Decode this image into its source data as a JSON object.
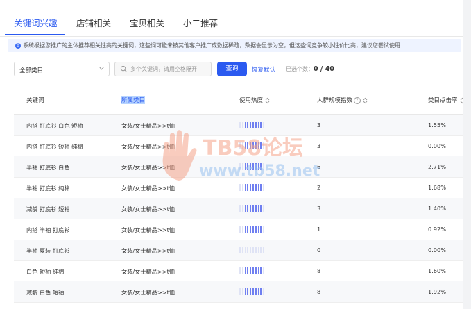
{
  "tabs": [
    {
      "label": "关键词兴趣",
      "active": true
    },
    {
      "label": "店铺相关",
      "active": false
    },
    {
      "label": "宝贝相关",
      "active": false
    },
    {
      "label": "小二推荐",
      "active": false
    }
  ],
  "notice": {
    "text": "系统根据您推广的主体推荐相关性高的关键词，这些词可能未被其他客户推广或数据稀疏，数据会显示为空，但这些词竞争较小性价比高，建议您尝试使用",
    "icon": "info-icon"
  },
  "filters": {
    "category_value": "全部类目",
    "search_placeholder": "多个关键词，请用空格隔开",
    "search_value": "",
    "query_label": "查询",
    "reset_label": "恢复默认",
    "selected_prefix": "已选个数：",
    "selected_count": "0 / 40"
  },
  "table": {
    "columns": [
      "关键词",
      "所属类目",
      "使用热度",
      "人群规模指数",
      "类目点击率"
    ],
    "heat_max": 10,
    "rows": [
      {
        "keyword": "内搭 打底衫 白色 短袖",
        "category": "女装/女士精品>>t恤",
        "heat": 7,
        "crowd": "3",
        "ctr": "1.55%"
      },
      {
        "keyword": "内搭 打底衫 短袖 纯棉",
        "category": "女装/女士精品>>t恤",
        "heat": 7,
        "crowd": "3",
        "ctr": "0.00%"
      },
      {
        "keyword": "半袖 打底衫 白色",
        "category": "女装/女士精品>>t恤",
        "heat": 7,
        "crowd": "6",
        "ctr": "2.71%"
      },
      {
        "keyword": "半袖 打底衫 纯棉",
        "category": "女装/女士精品>>t恤",
        "heat": 7,
        "crowd": "2",
        "ctr": "1.68%"
      },
      {
        "keyword": "减龄 打底衫 短袖",
        "category": "女装/女士精品>>t恤",
        "heat": 7,
        "crowd": "3",
        "ctr": "1.40%"
      },
      {
        "keyword": "内搭 半袖 打底衫",
        "category": "女装/女士精品>>t恤",
        "heat": 7,
        "crowd": "1",
        "ctr": "0.92%"
      },
      {
        "keyword": "半袖 夏装 打底衫",
        "category": "女装/女士精品>>t恤",
        "heat": 0,
        "crowd": "0",
        "ctr": "0.00%"
      },
      {
        "keyword": "白色 短袖 纯棉",
        "category": "女装/女士精品>>t恤",
        "heat": 7,
        "crowd": "8",
        "ctr": "1.60%"
      },
      {
        "keyword": "减龄 白色 短袖",
        "category": "女装/女士精品>>t恤",
        "heat": 7,
        "crowd": "8",
        "ctr": "1.92%"
      }
    ]
  },
  "watermark": {
    "brand": "TB58论坛",
    "url": "www.tb58.net"
  },
  "colors": {
    "accent": "#2b5af0",
    "heat_on": "#6f7ff0",
    "heat_off": "#dfe3f5"
  }
}
